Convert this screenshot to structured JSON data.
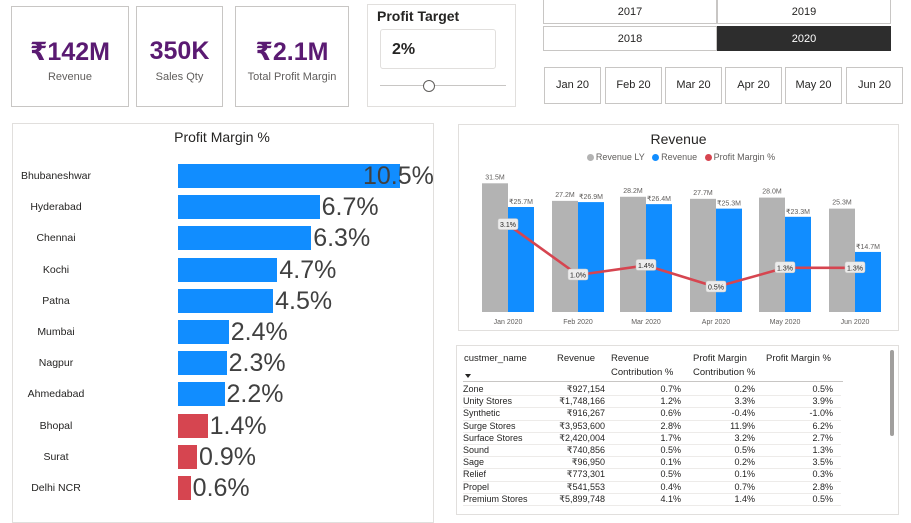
{
  "kpis": [
    {
      "value": "₹142M",
      "label": "Revenue"
    },
    {
      "value": "350K",
      "label": "Sales Qty"
    },
    {
      "value": "₹2.1M",
      "label": "Total Profit Margin"
    }
  ],
  "profit_target": {
    "title": "Profit Target",
    "value": "2%",
    "slider_value": 0.38
  },
  "year_slicer": {
    "options": [
      "2017",
      "2019",
      "2018",
      "2020"
    ],
    "selected": "2020"
  },
  "month_slicer": {
    "options": [
      "Jan 20",
      "Feb 20",
      "Mar 20",
      "Apr 20",
      "May 20",
      "Jun 20"
    ]
  },
  "colors": {
    "accent": "#5a1a72",
    "bar_blue": "#118dff",
    "bar_red": "#d64550",
    "bar_gray": "#b3b3b3",
    "line_red": "#d64550"
  },
  "chart_data": [
    {
      "type": "bar",
      "orientation": "horizontal",
      "title": "Profit Margin %",
      "categories": [
        "Bhubaneshwar",
        "Hyderabad",
        "Chennai",
        "Kochi",
        "Patna",
        "Mumbai",
        "Nagpur",
        "Ahmedabad",
        "Bhopal",
        "Surat",
        "Delhi NCR"
      ],
      "values": [
        10.5,
        6.7,
        6.3,
        4.7,
        4.5,
        2.4,
        2.3,
        2.2,
        1.4,
        0.9,
        0.6
      ],
      "value_labels": [
        "10.5%",
        "6.7%",
        "6.3%",
        "4.7%",
        "4.5%",
        "2.4%",
        "2.3%",
        "2.2%",
        "1.4%",
        "0.9%",
        "0.6%"
      ],
      "threshold": 2,
      "colors": {
        "above_target": "#118dff",
        "below_target": "#d64550"
      }
    },
    {
      "type": "bar",
      "title": "Revenue",
      "legend": [
        "Revenue LY",
        "Revenue",
        "Profit Margin %"
      ],
      "categories": [
        "Jan 2020",
        "Feb 2020",
        "Mar 2020",
        "Apr 2020",
        "May 2020",
        "Jun 2020"
      ],
      "series": [
        {
          "name": "Revenue LY",
          "values": [
            31.5,
            27.2,
            28.2,
            27.7,
            28.0,
            25.3
          ],
          "labels": [
            "31.5M",
            "27.2M",
            "28.2M",
            "27.7M",
            "28.0M",
            "25.3M"
          ]
        },
        {
          "name": "Revenue",
          "values": [
            25.7,
            26.9,
            26.4,
            25.3,
            23.3,
            14.7
          ],
          "labels": [
            "₹25.7M",
            "₹26.9M",
            "₹26.4M",
            "₹25.3M",
            "₹23.3M",
            "₹14.7M"
          ]
        },
        {
          "name": "Profit Margin %",
          "type": "line",
          "values": [
            3.1,
            1.0,
            1.4,
            0.5,
            1.3,
            1.3
          ],
          "labels": [
            "3.1%",
            "1.0%",
            "1.4%",
            "0.5%",
            "1.3%",
            "1.3%"
          ]
        }
      ],
      "ylim": [
        0,
        35
      ],
      "legend_position": "top-center"
    }
  ],
  "table": {
    "headers": [
      "custmer_name",
      "Revenue",
      "Revenue Contribution %",
      "Profit Margin Contribution %",
      "Profit Margin %"
    ],
    "rows": [
      [
        "Zone",
        "₹927,154",
        "0.7%",
        "0.2%",
        "0.5%"
      ],
      [
        "Unity Stores",
        "₹1,748,166",
        "1.2%",
        "3.3%",
        "3.9%"
      ],
      [
        "Synthetic",
        "₹916,267",
        "0.6%",
        "-0.4%",
        "-1.0%"
      ],
      [
        "Surge Stores",
        "₹3,953,600",
        "2.8%",
        "11.9%",
        "6.2%"
      ],
      [
        "Surface Stores",
        "₹2,420,004",
        "1.7%",
        "3.2%",
        "2.7%"
      ],
      [
        "Sound",
        "₹740,856",
        "0.5%",
        "0.5%",
        "1.3%"
      ],
      [
        "Sage",
        "₹96,950",
        "0.1%",
        "0.2%",
        "3.5%"
      ],
      [
        "Relief",
        "₹773,301",
        "0.5%",
        "0.1%",
        "0.3%"
      ],
      [
        "Propel",
        "₹541,553",
        "0.4%",
        "0.7%",
        "2.8%"
      ],
      [
        "Premium Stores",
        "₹5,899,748",
        "4.1%",
        "1.4%",
        "0.5%"
      ]
    ]
  }
}
